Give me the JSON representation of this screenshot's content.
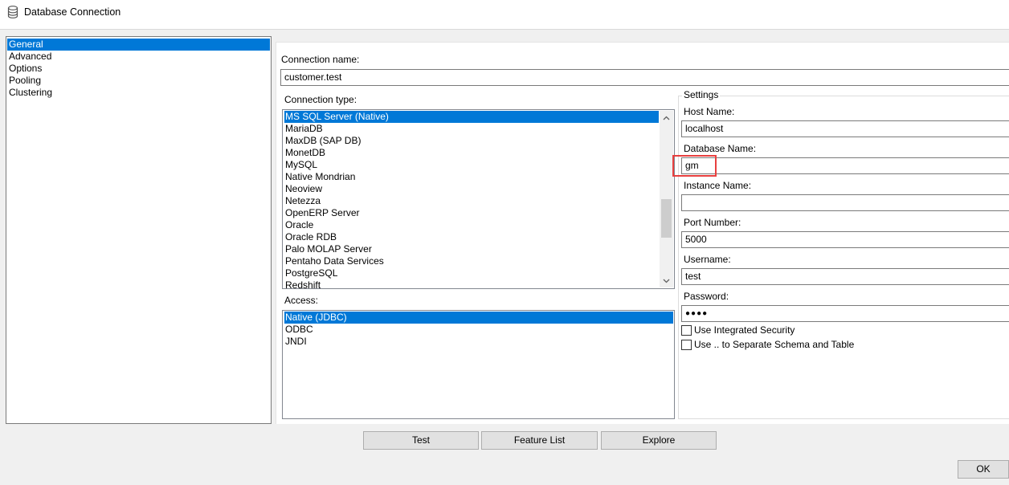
{
  "window": {
    "title": "Database Connection",
    "icon": "database-icon"
  },
  "nav": {
    "items": [
      "General",
      "Advanced",
      "Options",
      "Pooling",
      "Clustering"
    ],
    "selected_index": 0
  },
  "connection_name": {
    "label": "Connection name:",
    "value": "customer.test"
  },
  "connection_type": {
    "label": "Connection type:",
    "items": [
      "MS SQL Server (Native)",
      "MariaDB",
      "MaxDB (SAP DB)",
      "MonetDB",
      "MySQL",
      "Native Mondrian",
      "Neoview",
      "Netezza",
      "OpenERP Server",
      "Oracle",
      "Oracle RDB",
      "Palo MOLAP Server",
      "Pentaho Data Services",
      "PostgreSQL",
      "Redshift"
    ],
    "selected": "MS SQL Server (Native)"
  },
  "access": {
    "label": "Access:",
    "items": [
      "Native (JDBC)",
      "ODBC",
      "JNDI"
    ],
    "selected": "Native (JDBC)"
  },
  "settings": {
    "title": "Settings",
    "host_name": {
      "label": "Host Name:",
      "value": "localhost"
    },
    "database_name": {
      "label": "Database Name:",
      "value": "gm"
    },
    "instance_name": {
      "label": "Instance Name:",
      "value": ""
    },
    "port_number": {
      "label": "Port Number:",
      "value": "5000"
    },
    "username": {
      "label": "Username:",
      "value": "test"
    },
    "password": {
      "label": "Password:",
      "value": "●●●●"
    },
    "integrated_security": {
      "label": "Use Integrated Security",
      "checked": false
    },
    "separate_schema": {
      "label": "Use .. to Separate Schema and Table",
      "checked": false
    }
  },
  "buttons": {
    "test": "Test",
    "feature_list": "Feature List",
    "explore": "Explore",
    "ok": "OK"
  },
  "colors": {
    "selection": "#0078d7",
    "highlight": "#e8403f",
    "background": "#f0f0f0"
  }
}
